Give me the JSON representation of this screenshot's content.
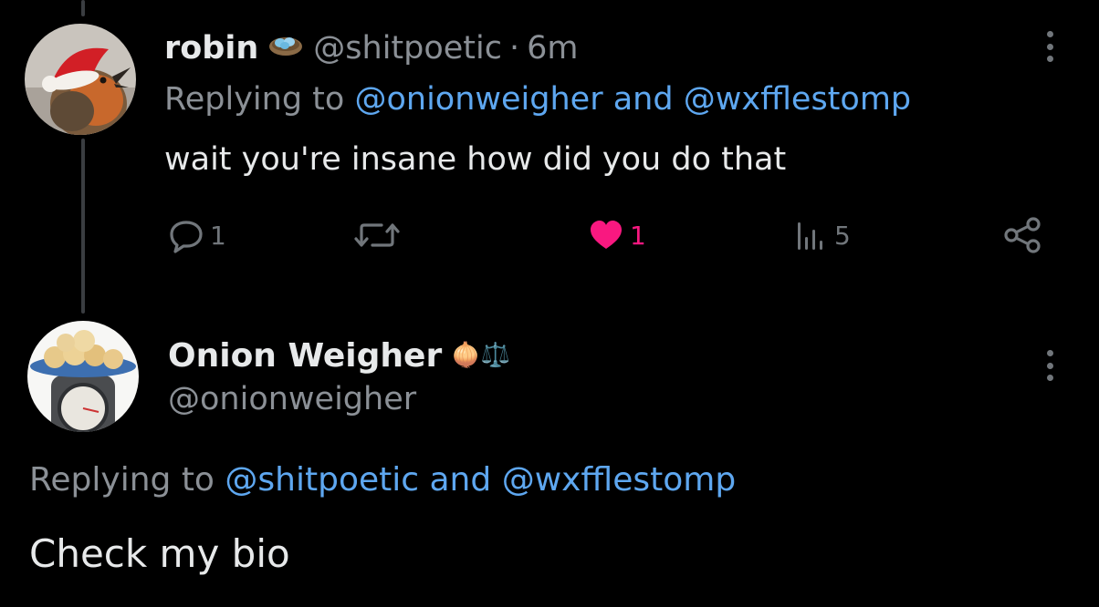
{
  "reply": {
    "display_name": "robin",
    "handle": "@shitpoetic",
    "separator": "·",
    "time": "6m",
    "replying_prefix": "Replying to",
    "replying_to_1": "@onionweigher",
    "replying_and": "and",
    "replying_to_2": "@wxfflestomp",
    "text": "wait you're insane how did you do that",
    "actions": {
      "reply_count": "1",
      "retweet_count": "",
      "like_count": "1",
      "views_count": "5"
    }
  },
  "main": {
    "display_name": "Onion Weigher",
    "name_emoji": "🧅⚖️",
    "handle": "@onionweigher",
    "replying_prefix": "Replying to",
    "replying_to_1": "@shitpoetic",
    "replying_and": "and",
    "replying_to_2": "@wxfflestomp",
    "text": "Check my bio"
  },
  "colors": {
    "background": "#000000",
    "text": "#e7e9ea",
    "secondary": "#8b9096",
    "link": "#5ea7f0",
    "like": "#f91880"
  }
}
